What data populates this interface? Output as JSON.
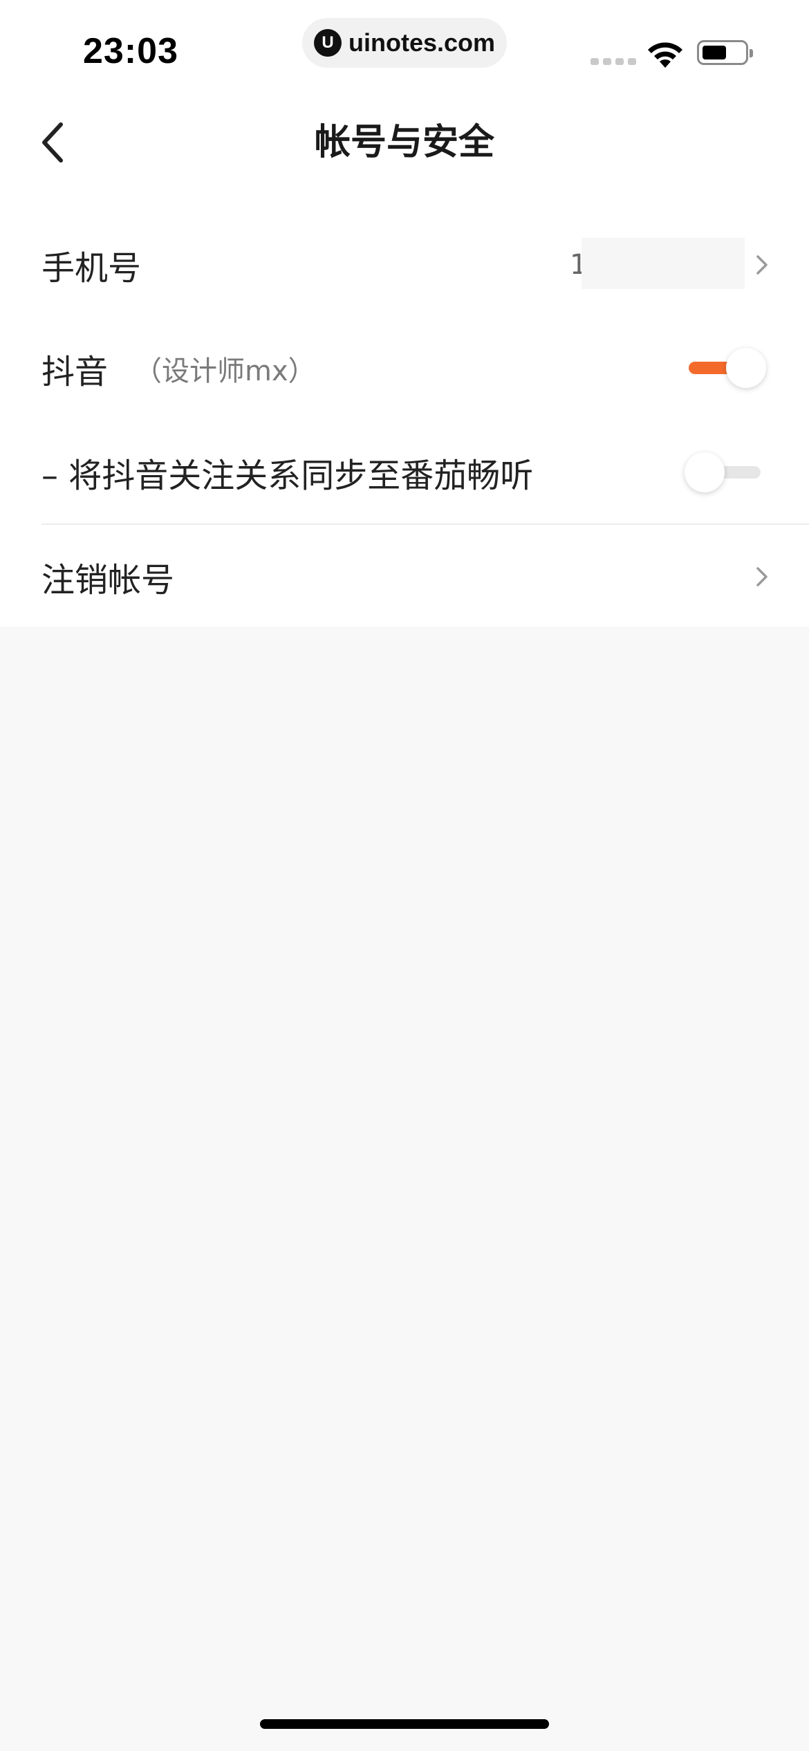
{
  "status_bar": {
    "time": "23:03",
    "url_logo_text": "U",
    "url": "uinotes.com",
    "icons": [
      "signal-icon",
      "wifi-icon",
      "battery-icon"
    ]
  },
  "nav": {
    "back_icon": "chevron-left-icon",
    "title": "帐号与安全"
  },
  "rows": {
    "phone": {
      "label": "手机号",
      "value": "1"
    },
    "douyin": {
      "label": "抖音",
      "account": "（设计师mx）",
      "toggle_on": true
    },
    "sync": {
      "label": "– 将抖音关注关系同步至番茄畅听",
      "toggle_on": false
    },
    "deactivate": {
      "label": "注销帐号"
    }
  },
  "colors": {
    "accent": "#f36a2b",
    "toggle_off_track": "#e6e6e6",
    "page_background": "#f8f8f8",
    "section_background": "#ffffff"
  }
}
